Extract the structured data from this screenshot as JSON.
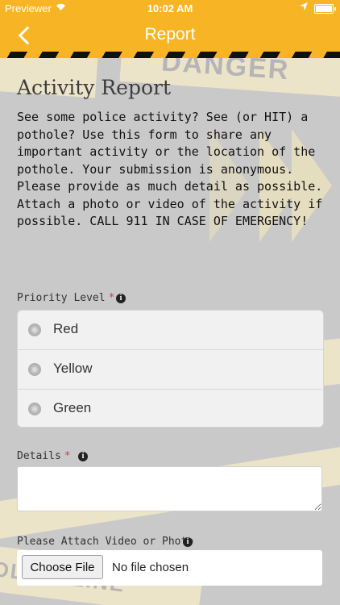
{
  "status_bar": {
    "carrier": "Previewer",
    "time": "10:02 AM"
  },
  "nav": {
    "title": "Report",
    "back_icon": "chevron-left-icon"
  },
  "background": {
    "tape_text_1": "DANGER",
    "tape_text_2": "OLICE LINE"
  },
  "form": {
    "title": "Activity Report",
    "intro": "See some police activity? See (or HIT) a pothole? Use this form to share any important activity or the location of the pothole. Your submission is anonymous. Please provide as much detail as possible. Attach a photo or video of the activity if possible. CALL 911 IN CASE OF EMERGENCY!",
    "priority": {
      "label": "Priority Level",
      "required_mark": "*",
      "options": [
        "Red",
        "Yellow",
        "Green"
      ]
    },
    "details": {
      "label": "Details",
      "required_mark": "*",
      "value": ""
    },
    "attachment": {
      "label": "Please Attach Video or Photo",
      "button_label": "Choose File",
      "status": "No file chosen"
    }
  },
  "colors": {
    "accent": "#f7b526",
    "required": "#e53935",
    "background": "#c9c9c9"
  }
}
